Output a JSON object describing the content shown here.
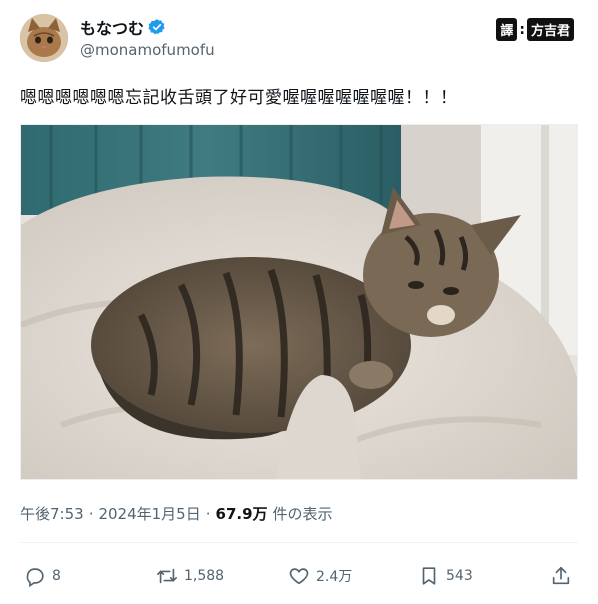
{
  "author": {
    "display_name": "もなつむ",
    "handle": "@monamofumofu",
    "verified": true
  },
  "translator_badge": {
    "label": "譯",
    "separator": ":",
    "name": "方吉君"
  },
  "tweet": {
    "text": "嗯嗯嗯嗯嗯嗯忘記收舌頭了好可愛喔喔喔喔喔喔喔！！！"
  },
  "meta": {
    "time": "午後7:53",
    "sep1": "·",
    "date": "2024年1月5日",
    "sep2": "·",
    "views": "67.9万",
    "views_label": "件の表示"
  },
  "actions": {
    "replies": "8",
    "reposts": "1,588",
    "likes": "2.4万",
    "bookmarks": "543"
  },
  "colors": {
    "verified_blue": "#1d9bf0",
    "muted_text": "#536471",
    "primary_text": "#0f1419"
  }
}
